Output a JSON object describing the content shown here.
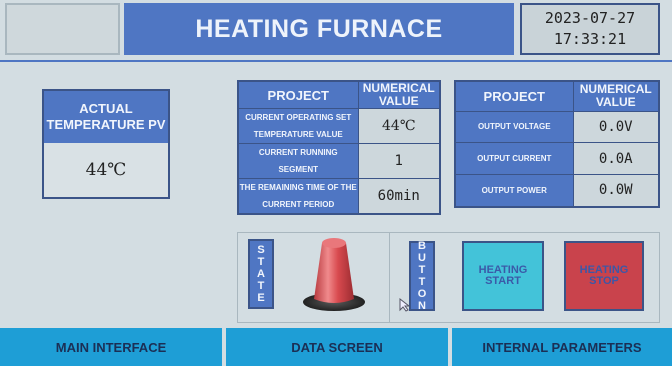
{
  "header": {
    "title": "HEATING FURNACE",
    "date": "2023-07-27",
    "time": "17:33:21"
  },
  "actual_temperature": {
    "label": "ACTUAL TEMPERATURE PV",
    "value": "44℃"
  },
  "process_table": {
    "col_project": "PROJECT",
    "col_value": "NUMERICAL VALUE",
    "rows": [
      {
        "label": "CURRENT OPERATING SET TEMPERATURE VALUE",
        "value": "44℃"
      },
      {
        "label": "CURRENT RUNNING SEGMENT",
        "value": "1"
      },
      {
        "label": "THE REMAINING TIME OF THE CURRENT PERIOD",
        "value": "60min"
      }
    ]
  },
  "output_table": {
    "col_project": "PROJECT",
    "col_value": "NUMERICAL VALUE",
    "rows": [
      {
        "label": "OUTPUT VOLTAGE",
        "value": "0.0V"
      },
      {
        "label": "OUTPUT CURRENT",
        "value": "0.0A"
      },
      {
        "label": "OUTPUT POWER",
        "value": "0.0W"
      }
    ]
  },
  "status": {
    "state_label": "STATE",
    "button_label": "BUTTON",
    "start_button": "HEATING START",
    "stop_button": "HEATING STOP",
    "indicator_color": "#d84a4f"
  },
  "nav": {
    "main": "MAIN INTERFACE",
    "data": "DATA SCREEN",
    "internal": "INTERNAL PARAMETERS"
  },
  "colors": {
    "panel_blue": "#4f76c3",
    "background": "#d3dde2",
    "nav_blue": "#1e9ed6",
    "start_cyan": "#43c3d9",
    "stop_red": "#c9434c"
  }
}
